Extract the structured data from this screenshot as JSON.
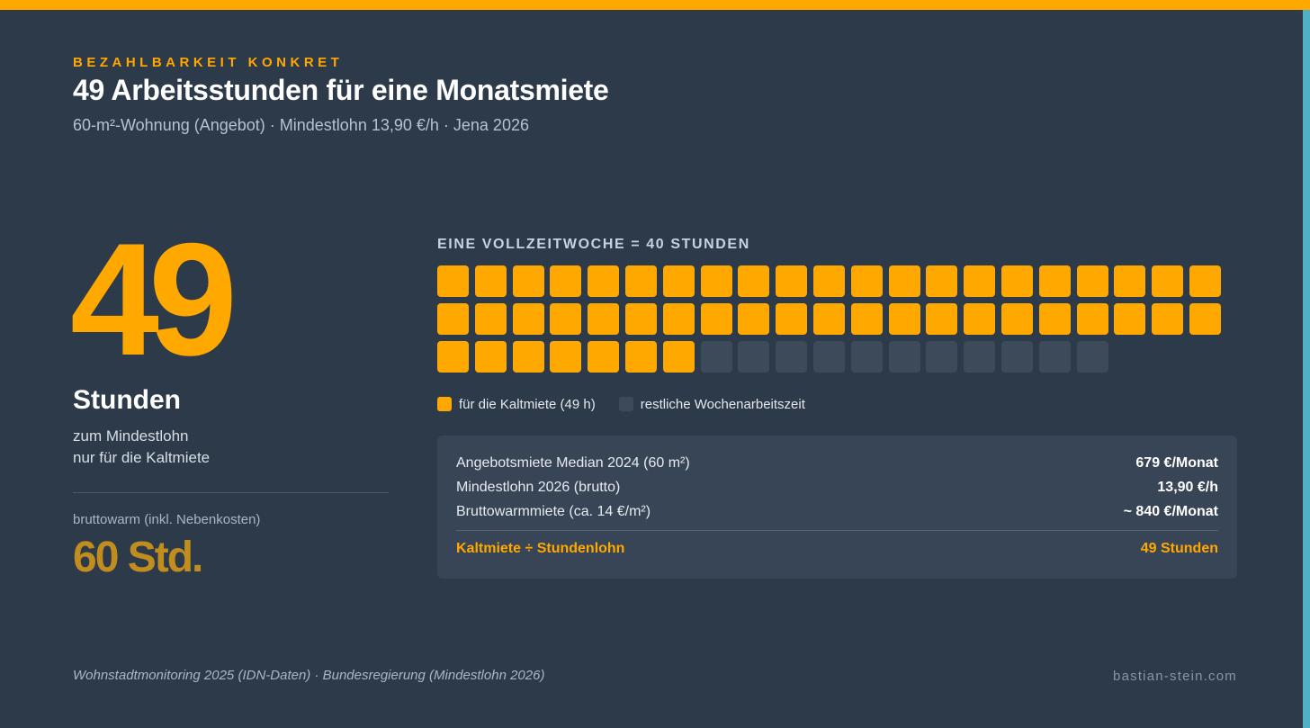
{
  "colors": {
    "accent": "#ffa800",
    "background": "#2d3a4a",
    "side_stripe": "#4fb0c6",
    "muted_accent": "#c08d1e",
    "empty_cell": "#3d4a5a"
  },
  "header": {
    "kicker": "BEZAHLBARKEIT KONKRET",
    "title": "49 Arbeitsstunden für eine Monatsmiete",
    "subtitle": "60-m²-Wohnung (Angebot) · Mindestlohn 13,90 €/h · Jena 2026"
  },
  "highlight": {
    "number": "49",
    "unit": "Stunden",
    "desc_line1": "zum Mindestlohn",
    "desc_line2": "nur für die Kaltmiete",
    "warm_label": "bruttowarm (inkl. Nebenkosten)",
    "warm_value": "60 Std."
  },
  "week_chart": {
    "heading": "EINE VOLLZEITWOCHE = 40 STUNDEN",
    "filled_hours": 49,
    "remaining_hours": 11,
    "legend_filled": "für die Kaltmiete (49 h)",
    "legend_remaining": "restliche Wochenarbeitszeit"
  },
  "calc": {
    "rows": [
      {
        "label": "Angebotsmiete Median 2024 (60 m²)",
        "value": "679 €/Monat"
      },
      {
        "label": "Mindestlohn 2026 (brutto)",
        "value": "13,90 €/h"
      },
      {
        "label": "Bruttowarmmiete (ca. 14 €/m²)",
        "value": "~ 840 €/Monat"
      }
    ],
    "total_label": "Kaltmiete ÷ Stundenlohn",
    "total_value": "49 Stunden"
  },
  "footer": {
    "source": "Wohnstadtmonitoring 2025 (IDN-Daten) · Bundesregierung (Mindestlohn 2026)",
    "brand": "bastian-stein.com"
  }
}
